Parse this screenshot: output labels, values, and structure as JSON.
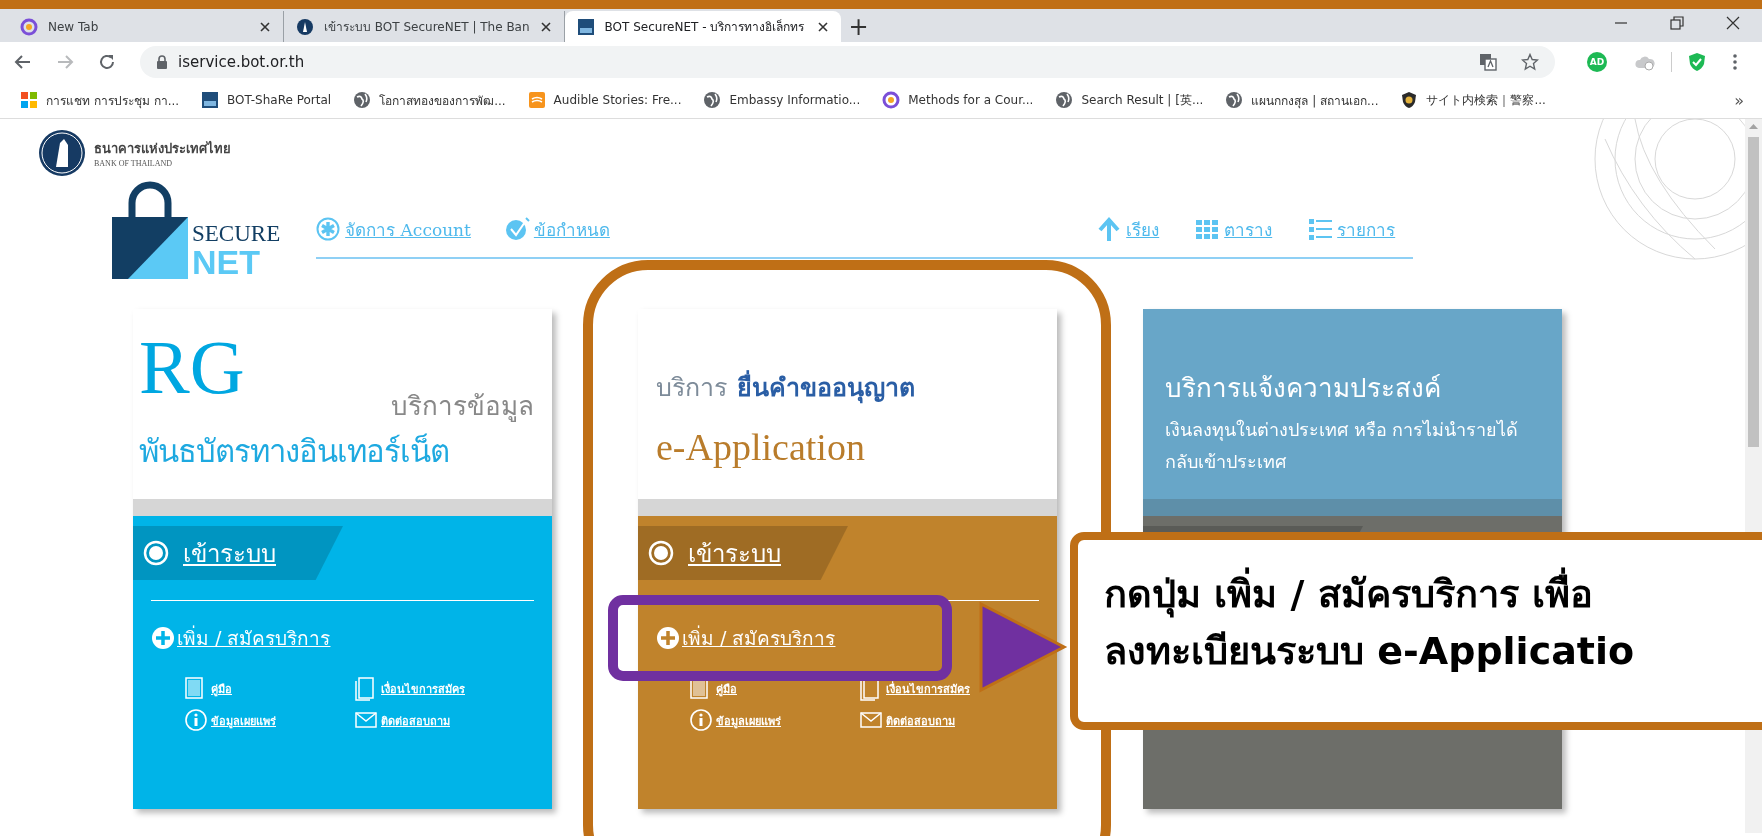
{
  "browser": {
    "tabs": [
      {
        "title": "New Tab",
        "selected": false
      },
      {
        "title": "เข้าระบบ BOT SecureNET | The Ban",
        "selected": false
      },
      {
        "title": "BOT SecureNET - บริการทางอิเล็กทร",
        "selected": true
      }
    ],
    "new_tab": "+",
    "address": "iservice.bot.or.th",
    "ad_badge": "AD",
    "bookmarks": [
      {
        "label": "การแชท การประชุม กา..."
      },
      {
        "label": "BOT-ShaRe Portal"
      },
      {
        "label": "โอกาสทองของการพัฒ..."
      },
      {
        "label": "Audible Stories: Fre..."
      },
      {
        "label": "Embassy Informatio..."
      },
      {
        "label": "Methods for a Cour..."
      },
      {
        "label": "Search Result | [英..."
      },
      {
        "label": "แผนกกงสุล | สถานเอก..."
      },
      {
        "label": "サイト内検索｜警察..."
      }
    ],
    "more": "»"
  },
  "page": {
    "bank_name": "ธนาคารแห่งประเทศไทย",
    "bank_name_en": "BANK OF THAILAND",
    "logo_top": "SECURE",
    "logo_bottom": "NET",
    "nav_left": [
      {
        "label": "จัดการ Account"
      },
      {
        "label": "ข้อกำหนด"
      }
    ],
    "nav_right": [
      {
        "label": "เรียง"
      },
      {
        "label": "ตาราง"
      },
      {
        "label": "รายการ"
      }
    ],
    "cards": [
      {
        "kind": "rg",
        "color": "#00b4e8",
        "title": "RG",
        "subtitle": "บริการข้อมูล",
        "subtitle_2": "พันธบัตรทางอินเทอร์เน็ต",
        "login": "เข้าระบบ",
        "register": "เพิ่ม / สมัครบริการ",
        "links": [
          {
            "label": "คู่มือ"
          },
          {
            "label": "เงื่อนไขการสมัคร"
          },
          {
            "label": "ข้อมูลเผยแพร่"
          },
          {
            "label": "ติดต่อสอบถาม"
          }
        ]
      },
      {
        "kind": "application",
        "color": "#c0832c",
        "prefix": "บริการ",
        "highlight": "ยื่นคำขออนุญาต",
        "title": "e-Application",
        "login": "เข้าระบบ",
        "register": "เพิ่ม / สมัครบริการ",
        "links": [
          {
            "label": "คู่มือ"
          },
          {
            "label": "เงื่อนไขการสมัคร"
          },
          {
            "label": "ข้อมูลเผยแพร่"
          },
          {
            "label": "ติดต่อสอบถาม"
          }
        ]
      },
      {
        "kind": "notice",
        "color": "#6d6e69",
        "title": "บริการแจ้งความประสงค์",
        "description": "เงินลงทุนในต่างประเทศ หรือ การไม่นำรายได้กลับเข้าประเทศ"
      }
    ]
  },
  "annotation": {
    "lines": [
      "กดปุ่ม เพิ่ม / สมัครบริการ เพื่อ",
      "ลงทะเบียนระบบ e-Applicatio"
    ]
  }
}
